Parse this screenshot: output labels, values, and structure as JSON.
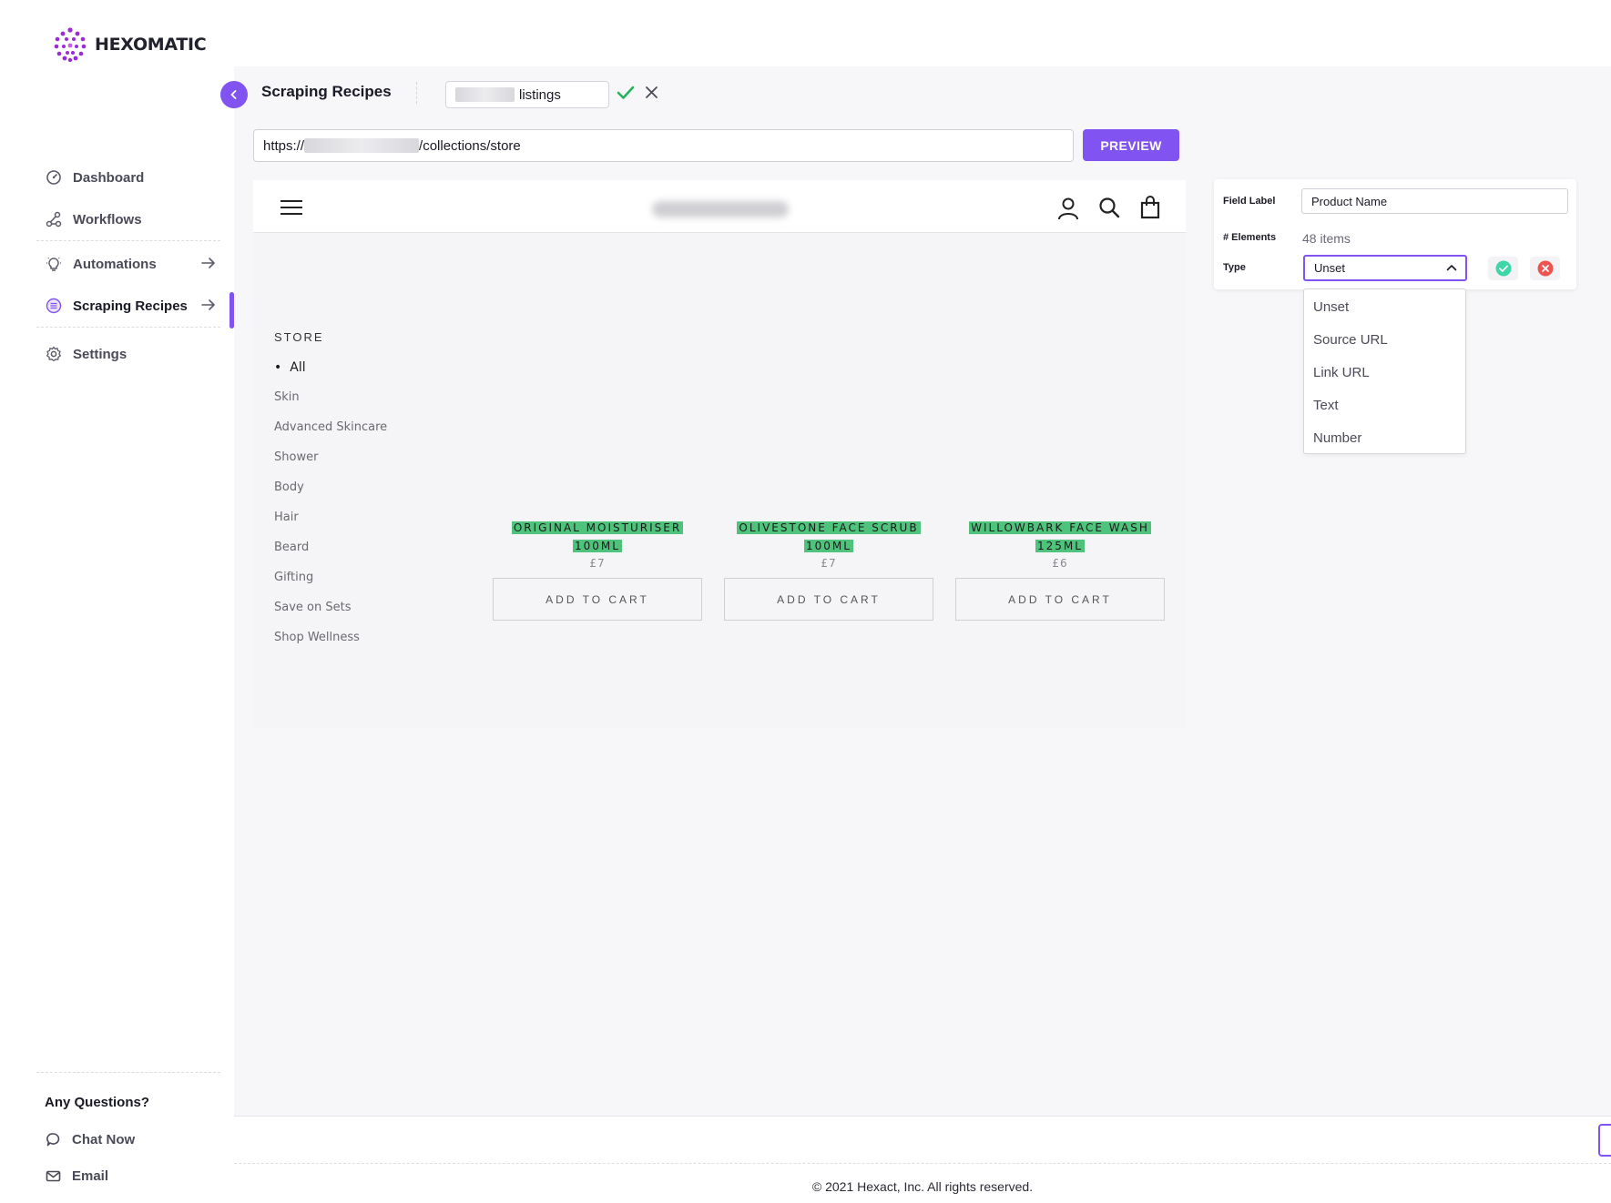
{
  "app": {
    "brand": "HEXOMATIC"
  },
  "sidebar": {
    "items": [
      {
        "label": "Dashboard",
        "icon": "dashboard-icon"
      },
      {
        "label": "Workflows",
        "icon": "workflow-icon"
      },
      {
        "label": "Automations",
        "icon": "bulb-icon"
      },
      {
        "label": "Scraping Recipes",
        "icon": "list-icon"
      },
      {
        "label": "Settings",
        "icon": "gear-icon"
      }
    ],
    "help_title": "Any Questions?",
    "help_items": [
      {
        "label": "Chat Now",
        "icon": "chat-icon"
      },
      {
        "label": "Email",
        "icon": "mail-icon"
      }
    ]
  },
  "header": {
    "title": "Scraping Recipes",
    "recipe_name_suffix": "listings"
  },
  "url_bar": {
    "prefix": "https://",
    "suffix": "/collections/store",
    "preview_label": "PREVIEW"
  },
  "preview_page": {
    "store_title": "STORE",
    "categories": [
      "All",
      "Skin",
      "Advanced Skincare",
      "Shower",
      "Body",
      "Hair",
      "Beard",
      "Gifting",
      "Save on Sets",
      "Shop Wellness"
    ],
    "products": [
      {
        "name_line1": "ORIGINAL MOISTURISER",
        "name_line2": "100ML",
        "price": "£7",
        "cta": "ADD TO CART"
      },
      {
        "name_line1": "OLIVESTONE FACE SCRUB",
        "name_line2": "100ML",
        "price": "£7",
        "cta": "ADD TO CART"
      },
      {
        "name_line1": "WILLOWBARK FACE WASH",
        "name_line2": "125ML",
        "price": "£6",
        "cta": "ADD TO CART"
      }
    ]
  },
  "field_editor": {
    "field_label_caption": "Field Label",
    "field_label_value": "Product Name",
    "elements_caption": "# Elements",
    "elements_value": "48 items",
    "type_caption": "Type",
    "type_value": "Unset",
    "type_options": [
      "Unset",
      "Source URL",
      "Link URL",
      "Text",
      "Number"
    ]
  },
  "footer": {
    "copyright": "© 2021 Hexact, Inc. All rights reserved."
  },
  "colors": {
    "accent": "#8153f0",
    "highlight": "#4fc37c",
    "confirm": "#3dd6a6",
    "danger": "#ef5350"
  }
}
